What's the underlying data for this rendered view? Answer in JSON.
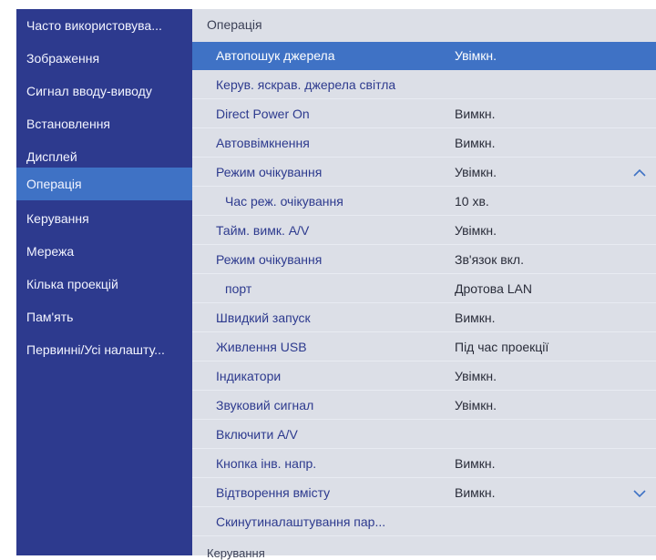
{
  "sidebar": {
    "items": [
      {
        "label": "Часто використовува..."
      },
      {
        "label": "Зображення"
      },
      {
        "label": "Сигнал вводу-виводу"
      },
      {
        "label": "Встановлення"
      },
      {
        "label": "Дисплей"
      },
      {
        "label": "Операція",
        "active": true
      },
      {
        "label": "Керування"
      },
      {
        "label": "Мережа"
      },
      {
        "label": "Кілька проекцій"
      },
      {
        "label": "Пам'ять"
      },
      {
        "label": "Первинні/Усі налашту..."
      }
    ]
  },
  "panel": {
    "title": "Операція",
    "next_section": "Керування",
    "rows": [
      {
        "label": "Автопошук джерела",
        "value": "Увімкн.",
        "selected": true
      },
      {
        "label": "Керув. яскрав. джерела світла",
        "value": ""
      },
      {
        "label": "Direct Power On",
        "value": "Вимкн."
      },
      {
        "label": "Автоввімкнення",
        "value": "Вимкн."
      },
      {
        "label": "Режим очікування",
        "value": "Увімкн."
      },
      {
        "label": "Час реж. очікування",
        "value": "10 хв.",
        "indent": true
      },
      {
        "label": "Тайм. вимк. A/V",
        "value": "Увімкн."
      },
      {
        "label": "Режим очікування",
        "value": "Зв'язок вкл."
      },
      {
        "label": "порт",
        "value": "Дротова LAN",
        "indent": true
      },
      {
        "label": "Швидкий запуск",
        "value": "Вимкн."
      },
      {
        "label": "Живлення USB",
        "value": "Під час проекції"
      },
      {
        "label": "Індикатори",
        "value": "Увімкн."
      },
      {
        "label": "Звуковий сигнал",
        "value": "Увімкн."
      },
      {
        "label": "Включити A/V",
        "value": ""
      },
      {
        "label": "Кнопка інв. напр.",
        "value": "Вимкн."
      },
      {
        "label": "Відтворення вмісту",
        "value": "Вимкн."
      },
      {
        "label": "Скинутиналаштування пар...",
        "value": ""
      }
    ],
    "scroll_up_icon": "chevron-up-icon",
    "scroll_down_icon": "chevron-down-icon"
  },
  "colors": {
    "sidebar_bg": "#2d3a8e",
    "accent": "#3f72c5",
    "panel_bg": "#dcdfe7",
    "label_text": "#2d3a8e"
  }
}
